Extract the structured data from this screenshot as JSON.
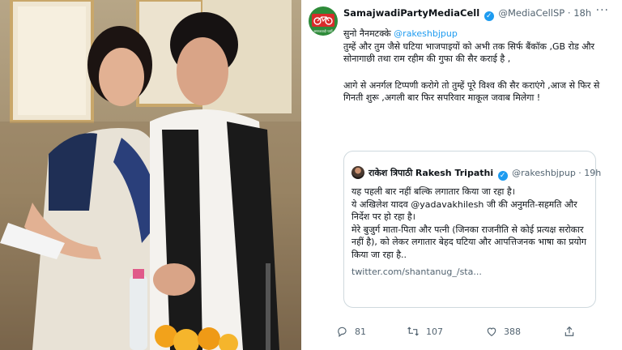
{
  "tweet": {
    "author_name": "SamajwadiPartyMediaCell",
    "author_handle": "@MediaCellSP",
    "time": "18h",
    "avatar_caption": "समाजवादी पार्टी",
    "body": {
      "line1_prefix": "सुनो नैनमटक्के ",
      "line1_mention": "@rakeshbjpup",
      "para1": "तुम्हें और तुम जैसे घटिया भाजपाइयों को अभी तक सिर्फ बैंकॉक ,GB रोड और सोनागाछी तथा राम रहीम की गुफा की सैर कराई है ,",
      "para2": "आगे से अनर्गल टिप्पणी करोगे तो तुम्हें पूरे विश्व की सैर कराएंगे ,आज से फिर से गिनती शुरू ,अगली बार फिर सपरिवार माकूल जवाब मिलेगा !"
    },
    "quoted": {
      "name_hindi": "राकेश त्रिपाठी",
      "name_english": "Rakesh Tripathi",
      "handle": "@rakeshbjpup",
      "time": "19h",
      "line1": "यह पहली बार नहीं बल्कि लगातार किया जा रहा है।",
      "line2_prefix": "ये अखिलेश यादव ",
      "line2_mention": "@yadavakhilesh",
      "line2_suffix": " जी की अनुमति-सहमति और निर्देश पर हो रहा है।",
      "line3": "मेरे बुजुर्ग माता-पिता और पत्नी (जिनका राजनीति से कोई प्रत्यक्ष सरोकार नहीं है), को लेकर लगातार बेहद घटिया और आपत्तिजनक भाषा का प्रयोग किया जा रहा है..",
      "url": "twitter.com/shantanug_/sta..."
    },
    "actions": {
      "replies": "81",
      "retweets": "107",
      "likes": "388"
    }
  },
  "colors": {
    "verified": "#1d9bf0",
    "link": "#1d9bf0",
    "muted": "#536471",
    "avatar_green": "#2e8b3a",
    "avatar_red": "#d92b2b"
  },
  "icons": [
    "verified-badge-icon",
    "more-icon",
    "reply-icon",
    "retweet-icon",
    "like-icon",
    "share-icon"
  ]
}
